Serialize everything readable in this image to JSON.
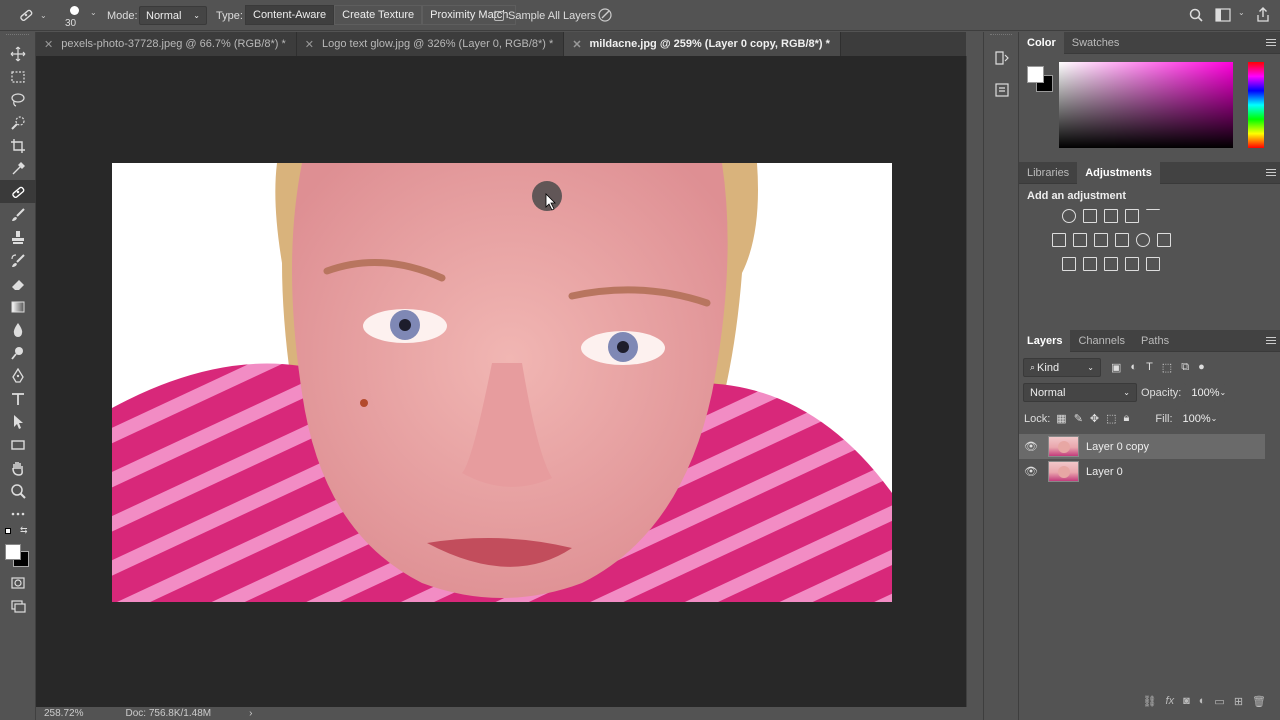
{
  "options_bar": {
    "brush_size": "30",
    "mode_label": "Mode:",
    "mode_value": "Normal",
    "type_label": "Type:",
    "type_options": [
      "Content-Aware",
      "Create Texture",
      "Proximity Match"
    ],
    "type_selected": "Content-Aware",
    "sample_all_layers_label": "Sample All Layers",
    "sample_all_layers_checked": false
  },
  "tabs": [
    {
      "label": "pexels-photo-37728.jpeg @ 66.7% (RGB/8*) *",
      "active": false
    },
    {
      "label": "Logo text glow.jpg @ 326% (Layer 0, RGB/8*) *",
      "active": false
    },
    {
      "label": "mildacne.jpg @ 259% (Layer 0 copy, RGB/8*) *",
      "active": true
    }
  ],
  "tools": [
    "move-icon",
    "marquee-icon",
    "lasso-icon",
    "quick-select-icon",
    "crop-icon",
    "eyedropper-icon",
    "spot-healing-icon",
    "brush-icon",
    "clone-stamp-icon",
    "history-brush-icon",
    "eraser-icon",
    "gradient-icon",
    "blur-icon",
    "dodge-icon",
    "pen-icon",
    "type-icon",
    "path-select-icon",
    "rectangle-icon",
    "hand-icon",
    "zoom-icon",
    "more-tools-icon"
  ],
  "selected_tool": "spot-healing-icon",
  "status": {
    "zoom": "258.72%",
    "doc": "Doc: 756.8K/1.48M",
    "arrow": "›"
  },
  "color_panel": {
    "tabs": [
      "Color",
      "Swatches"
    ],
    "active_tab": "Color",
    "foreground": "#ffffff",
    "background": "#000000",
    "hue_color": "#ff00dc"
  },
  "adjustments_panel": {
    "tabs": [
      "Libraries",
      "Adjustments"
    ],
    "active_tab": "Adjustments",
    "title": "Add an adjustment"
  },
  "layers_panel": {
    "tabs": [
      "Layers",
      "Channels",
      "Paths"
    ],
    "active_tab": "Layers",
    "filter_kind": "Kind",
    "blend_mode": "Normal",
    "opacity_label": "Opacity:",
    "opacity_value": "100%",
    "lock_label": "Lock:",
    "fill_label": "Fill:",
    "fill_value": "100%",
    "layers": [
      {
        "name": "Layer 0 copy",
        "visible": true,
        "selected": true
      },
      {
        "name": "Layer 0",
        "visible": true,
        "selected": false
      }
    ]
  },
  "colors": {
    "ui_bg": "#535353",
    "canvas_bg": "#282828",
    "shirt_pink": "#d8287a",
    "skin": "#eaa7a6"
  }
}
